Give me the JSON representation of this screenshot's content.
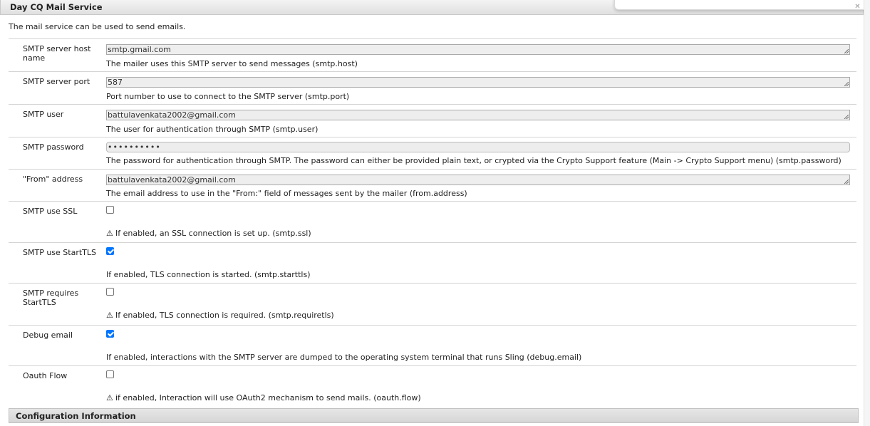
{
  "dialog": {
    "title": "Day CQ Mail Service",
    "description": "The mail service can be used to send emails.",
    "footer_title": "Configuration Information"
  },
  "fields": {
    "host": {
      "label": "SMTP server host name",
      "value": "smtp.gmail.com",
      "help": "The mailer uses this SMTP server to send messages (smtp.host)"
    },
    "port": {
      "label": "SMTP server port",
      "value": "587",
      "help": "Port number to use to connect to the SMTP server (smtp.port)"
    },
    "user": {
      "label": "SMTP user",
      "value": "battulavenkata2002@gmail.com",
      "help": "The user for authentication through SMTP (smtp.user)"
    },
    "password": {
      "label": "SMTP password",
      "value": "••••••••••",
      "help": "The password for authentication through SMTP. The password can either be provided plain text, or crypted via the Crypto Support feature (Main -> Crypto Support menu) (smtp.password)"
    },
    "from": {
      "label": "\"From\" address",
      "value": "battulavenkata2002@gmail.com",
      "help": "The email address to use in the \"From:\" field of messages sent by the mailer (from.address)"
    },
    "ssl": {
      "label": "SMTP use SSL",
      "checked": false,
      "warning": true,
      "help": "If enabled, an SSL connection is set up. (smtp.ssl)"
    },
    "starttls": {
      "label": "SMTP use StartTLS",
      "checked": true,
      "warning": false,
      "help": "If enabled, TLS connection is started. (smtp.starttls)"
    },
    "requiretls": {
      "label": "SMTP requires StartTLS",
      "checked": false,
      "warning": true,
      "help": "If enabled, TLS connection is required. (smtp.requiretls)"
    },
    "debug": {
      "label": "Debug email",
      "checked": true,
      "warning": false,
      "help": "If enabled, interactions with the SMTP server are dumped to the operating system terminal that runs Sling (debug.email)"
    },
    "oauth": {
      "label": "Oauth Flow",
      "checked": false,
      "warning": true,
      "help": "if enabled, Interaction will use OAuth2 mechanism to send mails. (oauth.flow)"
    }
  },
  "icons": {
    "warning": "warning-triangle-icon",
    "close": "close-icon"
  },
  "colors": {
    "checkbox_checked": "#0075ff",
    "titlebar": "#e0e0e0"
  }
}
